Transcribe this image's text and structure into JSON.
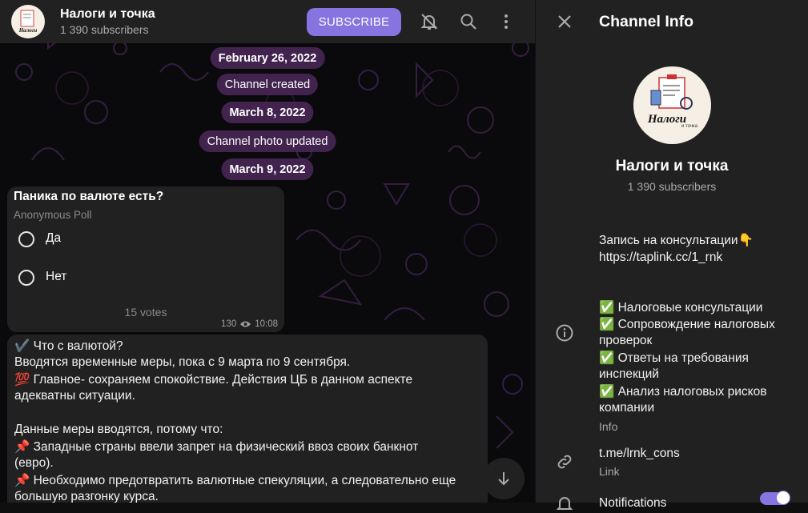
{
  "header": {
    "title": "Налоги и точка",
    "subscribers": "1 390 subscribers",
    "subscribe_label": "SUBSCRIBE",
    "icons": [
      "bell-off-icon",
      "search-icon",
      "more-vertical-icon"
    ]
  },
  "timeline": [
    "February 26, 2022",
    "Channel created",
    "March 8, 2022",
    "Channel photo updated",
    "March 9, 2022"
  ],
  "poll": {
    "question": "Паника по валюте есть?",
    "type": "Anonymous Poll",
    "options": [
      "Да",
      "Нет"
    ],
    "votes": "15 votes",
    "views": "130",
    "time": "10:08"
  },
  "post": {
    "lines": [
      "✔️ Что с валютой?",
      "Вводятся временные меры, пока с 9 марта по 9 сентября.",
      "💯 Главное- сохраняем спокойствие. Действия ЦБ в данном аспекте",
      "адекватны ситуации.",
      "",
      " Данные меры вводятся, потому что:",
      "📌 Западные страны ввели запрет на физический ввоз своих банкнот",
      "(евро).",
      "📌  Необходимо предотвратить валютные спекуляции, а следовательно еще",
      "большую разгонку курса."
    ]
  },
  "info": {
    "title": "Channel Info",
    "name": "Налоги и точка",
    "subscribers": "1 390 subscribers",
    "logo_text": "Налоги",
    "logo_sub": "и точка",
    "description_top": [
      "Запись на консультации👇",
      "https://taplink.cc/1_rnk"
    ],
    "description_list": [
      "✅ Налоговые консультации",
      "✅ Сопровождение налоговых",
      "проверок",
      "✅ Ответы на требования",
      "инспекций",
      "✅ Анализ налоговых рисков",
      "компании"
    ],
    "info_label": "Info",
    "link": "t.me/lrnk_cons",
    "link_label": "Link",
    "notifications_label": "Notifications",
    "notifications_on": true,
    "accent": "#8774e1"
  }
}
